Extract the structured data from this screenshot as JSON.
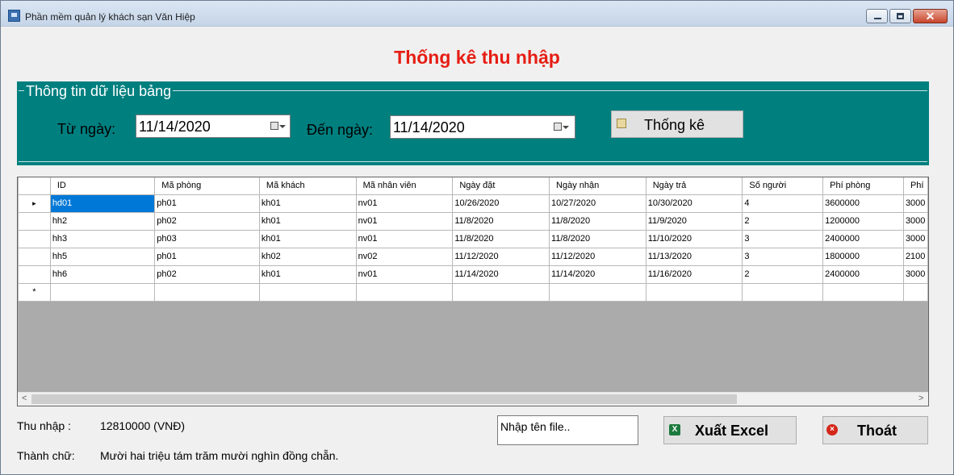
{
  "window": {
    "title": "Phần mềm quản lý khách sạn Văn Hiệp",
    "close_glyph": "✕"
  },
  "page_title": "Thống kê thu nhập",
  "filter": {
    "legend": "Thông tin dữ liệu  bảng",
    "from_label": "Từ ngày:",
    "from_value": "11/14/2020",
    "to_label": "Đến ngày:",
    "to_value": "11/14/2020",
    "stat_button": "Thống kê"
  },
  "grid": {
    "columns": [
      "ID",
      "Mã phòng",
      "Mã khách",
      "Mã nhân viên",
      "Ngày đặt",
      "Ngày nhận",
      "Ngày trả",
      "Số người",
      "Phí phòng",
      "Phí"
    ],
    "rows": [
      [
        "hd01",
        "ph01",
        "kh01",
        "nv01",
        "10/26/2020",
        "10/27/2020",
        "10/30/2020",
        "4",
        "3600000",
        "3000"
      ],
      [
        "hh2",
        "ph02",
        "kh01",
        "nv01",
        "11/8/2020",
        "11/8/2020",
        "11/9/2020",
        "2",
        "1200000",
        "3000"
      ],
      [
        "hh3",
        "ph03",
        "kh01",
        "nv01",
        "11/8/2020",
        "11/8/2020",
        "11/10/2020",
        "3",
        "2400000",
        "3000"
      ],
      [
        "hh5",
        "ph01",
        "kh02",
        "nv02",
        "11/12/2020",
        "11/12/2020",
        "11/13/2020",
        "3",
        "1800000",
        "2100"
      ],
      [
        "hh6",
        "ph02",
        "kh01",
        "nv01",
        "11/14/2020",
        "11/14/2020",
        "11/16/2020",
        "2",
        "2400000",
        "3000"
      ]
    ],
    "current_row_glyph": "▸",
    "new_row_glyph": "*",
    "scroll_left": "<",
    "scroll_right": ">"
  },
  "summary": {
    "income_label": "Thu nhập :",
    "income_value": "12810000 (VNĐ)",
    "words_label": "Thành chữ:",
    "words_value": "Mười hai triệu tám trăm mười nghìn đồng chẵn."
  },
  "actions": {
    "file_placeholder": "Nhập tên file..",
    "export_button": "Xuất Excel",
    "exit_button": "Thoát",
    "excel_glyph": "X",
    "exit_glyph": "×"
  },
  "colors": {
    "heading": "#e61e14",
    "panel": "#007f7f",
    "selection": "#0078d7"
  },
  "icons": [
    "app-icon",
    "minimize-icon",
    "maximize-icon",
    "close-icon",
    "calendar-icon",
    "statistics-icon",
    "excel-icon",
    "exit-icon"
  ]
}
